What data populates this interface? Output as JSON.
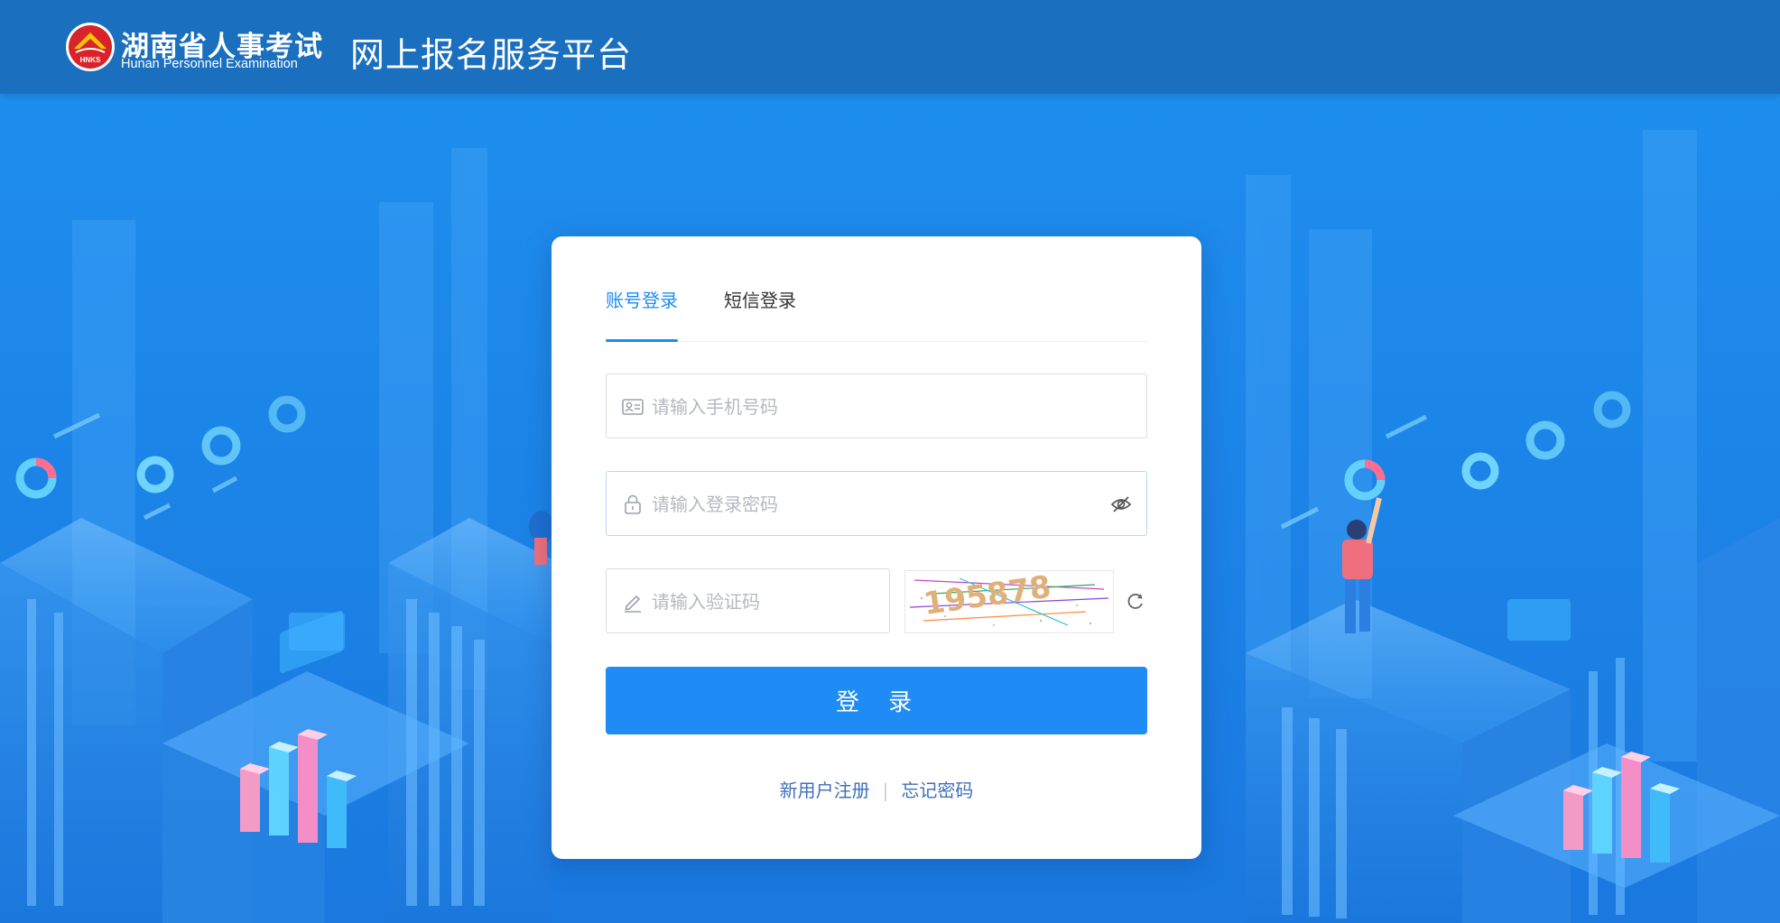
{
  "header": {
    "logo_cn": "湖南省人事考试",
    "logo_en": "Hunan Personnel Examination",
    "logo_badge": "HNKS",
    "platform_title": "网上报名服务平台"
  },
  "login": {
    "tabs": [
      {
        "label": "账号登录",
        "active": true
      },
      {
        "label": "短信登录",
        "active": false
      }
    ],
    "phone": {
      "placeholder": "请输入手机号码",
      "value": "",
      "icon": "id-card-icon"
    },
    "password": {
      "placeholder": "请输入登录密码",
      "value": "",
      "icon": "lock-icon",
      "toggle_icon": "eye-slash-icon"
    },
    "captcha": {
      "placeholder": "请输入验证码",
      "value": "",
      "icon": "pencil-icon",
      "code": "195878",
      "refresh_icon": "refresh-icon"
    },
    "submit_label": "登 录",
    "register_link": "新用户注册",
    "separator": "|",
    "forgot_link": "忘记密码"
  },
  "colors": {
    "header_bg": "#1a6fbe",
    "page_bg": "#1d8ae9",
    "accent": "#1e8cf4",
    "link": "#3f6fb7"
  }
}
